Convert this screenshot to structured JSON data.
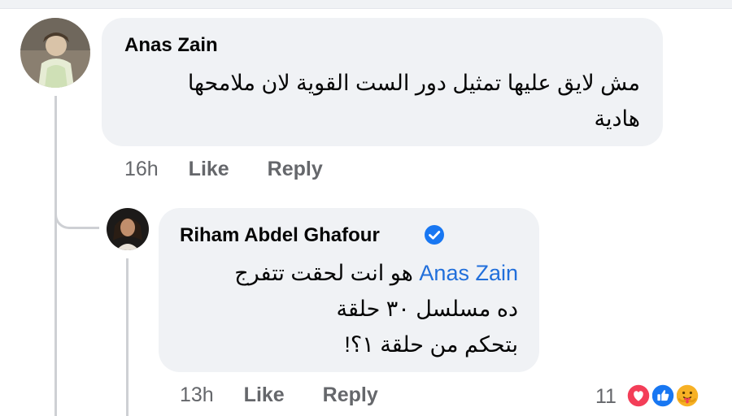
{
  "comments": [
    {
      "author": "Anas Zain",
      "text_lines": [
        "مش لايق عليها تمثيل دور الست القوية لان ملامحها",
        "هادية"
      ],
      "time": "16h",
      "like_label": "Like",
      "reply_label": "Reply"
    }
  ],
  "reply": {
    "author": "Riham Abdel Ghafour",
    "verified_icon": "verified-badge-icon",
    "mention": "Anas Zain",
    "line1_rest": "هو انت لحقت تتفرج",
    "line2": "ده مسلسل ٣٠ حلقة",
    "line3": "بتحكم من حلقة ١؟!",
    "time": "13h",
    "like_label": "Like",
    "reply_label": "Reply",
    "reaction_count": "11",
    "reaction_icons": [
      "love-reaction-icon",
      "like-reaction-icon",
      "care-reaction-icon"
    ]
  },
  "colors": {
    "bubble": "#f0f2f5",
    "meta_text": "#65676b",
    "mention": "#216fdb",
    "verified": "#1877f2",
    "love": "#f33e58",
    "like": "#1877f2",
    "care": "#f7b125"
  }
}
